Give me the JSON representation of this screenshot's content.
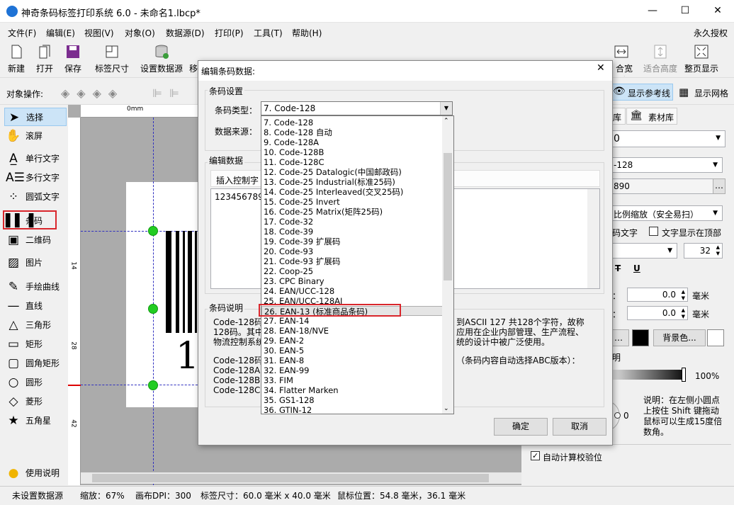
{
  "window": {
    "title": "神奇条码标签打印系统 6.0 - 未命名1.lbcp*",
    "minimize": "—",
    "maximize": "☐",
    "close": "✕"
  },
  "menu": {
    "items": [
      "文件(F)",
      "编辑(E)",
      "视图(V)",
      "对象(O)",
      "数据源(D)",
      "打印(P)",
      "工具(T)",
      "帮助(H)"
    ],
    "license": "永久授权"
  },
  "toolbar": {
    "new": "新建",
    "open": "打开",
    "save": "保存",
    "label_size": "标签尺寸",
    "set_datasource": "设置数据源",
    "partial": "移",
    "fit_width": "适合宽度",
    "fit_height": "适合高度",
    "full_page": "整页显示",
    "fit_width_short": "合宽度"
  },
  "objbar": {
    "label": "对象操作:",
    "show_guides": "显示参考线",
    "show_grid": "显示网格"
  },
  "tools": {
    "select": "选择",
    "scroll": "滚屏",
    "single_text": "单行文字",
    "multi_text": "多行文字",
    "arc_text": "圆弧文字",
    "barcode": "条码",
    "qrcode": "二维码",
    "image": "图片",
    "freehand": "手绘曲线",
    "line": "直线",
    "triangle": "三角形",
    "rect": "矩形",
    "round_rect": "圆角矩形",
    "circle": "圆形",
    "diamond": "菱形",
    "star": "五角星",
    "help": "使用说明"
  },
  "ruler": {
    "h0": "0mm",
    "v14": "14",
    "v28": "28",
    "v42": "42"
  },
  "canvas": {
    "barcode_digit": "1"
  },
  "right": {
    "tab_lib": "库",
    "tab_material": "素材库",
    "field1": "0",
    "field2": "-128",
    "field3": "890",
    "scale": "比例缩放（安全易扫）",
    "code_text": "码文字",
    "text_top": "文字显示在顶部",
    "font_size": "32",
    "t_icon": "T",
    "u_icon": "U",
    "dx_label": "：",
    "dy_label": "：",
    "dx": "0.0",
    "dy": "0.0",
    "unit": "毫米",
    "bg_color": "背景色...",
    "transparency_label": "明",
    "transparency": "100%",
    "rotation": "0",
    "note": "说明：在左侧小圆点上按住 Shift 键拖动鼠标可以生成15度倍数角。",
    "auto_check": "自动计算校验位"
  },
  "status": {
    "datasource": "未设置数据源",
    "zoom": "缩放：67%",
    "dpi": "画布DPI：300",
    "label_size": "标签尺寸：60.0 毫米 x 40.0 毫米",
    "mouse": "鼠标位置：54.8 毫米，36.1 毫米"
  },
  "dialog": {
    "title": "编辑条码数据:",
    "settings_group": "条码设置",
    "type_label": "条码类型：",
    "type_value": "7. Code-128",
    "source_label": "数据来源：",
    "edit_group": "编辑数据",
    "insert_ctrl": "插入控制字",
    "data_value": "123456789",
    "desc_group": "条码说明",
    "desc_left": [
      "Code-128码",
      "128码。其中",
      "物流控制系统"
    ],
    "desc_right": [
      "到ASCII 127 共128个字符，故称",
      "应用在企业内部管理、生产流程、",
      "统的设计中被广泛使用。"
    ],
    "desc_left2": [
      "Code-128码",
      "Code-128A:",
      "Code-128B:",
      "Code-128C:"
    ],
    "desc_right2": "（条码内容自动选择ABC版本）：",
    "ok": "确定",
    "cancel": "取消",
    "options": [
      "7.  Code-128",
      "8.  Code-128 自动",
      "9.  Code-128A",
      "10.  Code-128B",
      "11.  Code-128C",
      "12.  Code-25 Datalogic(中国邮政码)",
      "13.  Code-25 Industrial(标准25码)",
      "14.  Code-25 Interleaved(交叉25码)",
      "15.  Code-25 Invert",
      "16.  Code-25 Matrix(矩阵25码)",
      "17.  Code-32",
      "18.  Code-39",
      "19.  Code-39 扩展码",
      "20.  Code-93",
      "21.  Code-93 扩展码",
      "22.  Coop-25",
      "23.  CPC Binary",
      "24.  EAN/UCC-128",
      "25.  EAN/UCC-128AI",
      "26.  EAN-13 (标准商品条码)",
      "27.  EAN-14",
      "28.  EAN-18/NVE",
      "29.  EAN-2",
      "30.  EAN-5",
      "31.  EAN-8",
      "32.  EAN-99",
      "33.  FIM",
      "34.  Flatter Marken",
      "35.  GS1-128",
      "36.  GTIN-12"
    ],
    "selected_index": 19
  }
}
